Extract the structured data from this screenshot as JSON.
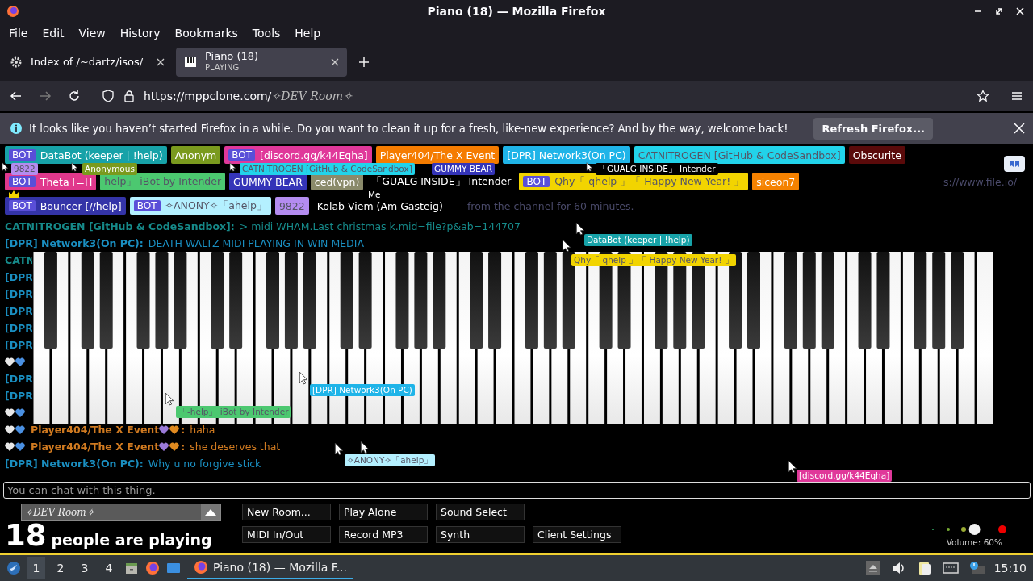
{
  "window": {
    "title": "Piano (18) — Mozilla Firefox"
  },
  "menu": [
    "File",
    "Edit",
    "View",
    "History",
    "Bookmarks",
    "Tools",
    "Help"
  ],
  "tabs": [
    {
      "title": "Index of /~dartz/isos/",
      "selected": false
    },
    {
      "title": "Piano (18)",
      "subtitle": "PLAYING",
      "selected": true
    }
  ],
  "address": {
    "url": "https://mppclone.com/",
    "room": "✧DEV Room✧"
  },
  "notification": {
    "message": "It looks like you haven’t started Firefox in a while. Do you want to clean it up for a fresh, like-new experience? And by the way, welcome back!",
    "button": "Refresh Firefox..."
  },
  "name_tags": [
    [
      {
        "badge": "BOT",
        "label": "DataBot (keeper | !help)",
        "color": "#17a2a8"
      },
      {
        "label": "Anonym",
        "color": "#7a9a1e"
      },
      {
        "badge": "BOT",
        "label": "[discord.gg/k44Eqha]",
        "color": "#e0389a"
      },
      {
        "label": "Player404/The X Event",
        "color": "#f57c00"
      },
      {
        "label": "[DPR] Network3(On PC)",
        "color": "#1fb4e8"
      },
      {
        "label": "CATNITROGEN [GitHub & CodeSandbox]",
        "color": "#22d3ea"
      },
      {
        "label": "Obscurite",
        "color": "#5a0a0a"
      }
    ],
    [
      {
        "badge": "BOT",
        "label": "Theta [=H",
        "color": "#e0388c"
      },
      {
        "label": "help」 iBot by Intender",
        "color": "#4cc870"
      },
      {
        "label": "GUMMY BEAR",
        "color": "#3434b8"
      },
      {
        "label": "ced(vpn)",
        "color": "#8a8a6a"
      },
      {
        "label": "「GUALG INSIDE」 Intender",
        "color": "#000000"
      },
      {
        "badge": "BOT",
        "label": "Qhy「 qhelp 」「 Happy New Year! 」",
        "color": "#f2d400"
      },
      {
        "label": "siceon7",
        "color": "#f58200"
      }
    ],
    [
      {
        "badge": "BOT",
        "label": "Bouncer [//help]",
        "color": "#3434a8"
      },
      {
        "badge": "BOT",
        "label": "✧ANONY✧「ahelp」",
        "color": "#b4f0ff"
      },
      {
        "label": "9822",
        "color": "#b48cf0"
      },
      {
        "label": "Kolab Viem (Am Gasteig)"
      }
    ]
  ],
  "faded_texts": [
    "from the channel for 60 minutes.",
    "s://www.file.io/"
  ],
  "cursor_labels": [
    {
      "label": "9822",
      "color": "#b48cf0"
    },
    {
      "label": "Anonymous",
      "color": "#7a9a1e"
    },
    {
      "label": "CATNITROGEN [GitHub & CodeSandbox]",
      "color": "#22d3ea"
    },
    {
      "label": "GUMMY BEAR",
      "color": "#3434b8"
    },
    {
      "label": "「GUALG INSIDE」 Intender",
      "color": "#000000"
    },
    {
      "label": "Me"
    },
    {
      "label": "DataBot (keeper | !help)",
      "color": "#17a2a8"
    },
    {
      "label": "Qhy「 qhelp 」「 Happy New Year! 」",
      "color": "#f2d400"
    },
    {
      "label": "[DPR] Network3(On PC)",
      "color": "#1fb4e8"
    },
    {
      "label": "「-help」 iBot by Intender",
      "color": "#4cc870"
    },
    {
      "label": "✧ANONY✧「ahelp」",
      "color": "#b4f0ff"
    },
    {
      "label": "[discord.gg/k44Eqha]",
      "color": "#e0389a"
    }
  ],
  "chat": [
    {
      "kind": "message",
      "name": "CATNITROGEN [GitHub & CodeSandbox]:",
      "text": "> midi WHAM.Last christmas k.mid=file?p&ab=144707",
      "color": "#168a8a"
    },
    {
      "kind": "message",
      "name": "[DPR] Network3(On PC):",
      "text": "DEATH WALTZ MIDI PLAYING IN WIN MEDIA",
      "color": "#1a8ec0"
    },
    {
      "kind": "cut",
      "name": "CATN",
      "color": "#168a8a"
    },
    {
      "kind": "cut",
      "name": "[DPR",
      "color": "#1a8ec0"
    },
    {
      "kind": "cut",
      "name": "[DPR",
      "color": "#1a8ec0"
    },
    {
      "kind": "cut",
      "name": "[DPR",
      "color": "#1a8ec0"
    },
    {
      "kind": "cut",
      "name": "[DPR",
      "color": "#1a8ec0"
    },
    {
      "kind": "cut",
      "name": "[DPR",
      "color": "#1a8ec0"
    },
    {
      "kind": "cut",
      "hearts": true
    },
    {
      "kind": "cut",
      "name": "[DPR",
      "color": "#1a8ec0"
    },
    {
      "kind": "cut",
      "name": "[DPR",
      "color": "#1a8ec0"
    },
    {
      "kind": "cut",
      "hearts": true
    },
    {
      "kind": "message",
      "hearts": true,
      "name": "Player404/The X Event",
      "separator": ":",
      "text": "haha",
      "color": "#d07a20"
    },
    {
      "kind": "message",
      "hearts": true,
      "name": "Player404/The X Event",
      "separator": ":",
      "text": "she deserves that",
      "color": "#d07a20"
    },
    {
      "kind": "message",
      "name": "[DPR] Network3(On PC):",
      "text": "Why u no forgive stick",
      "color": "#1a8ec0"
    }
  ],
  "chat_input": {
    "placeholder": "You can chat with this thing."
  },
  "room_select": {
    "value": "✧DEV Room✧"
  },
  "player_count": {
    "count": "18",
    "label": "people are playing"
  },
  "buttons": [
    [
      "New Room...",
      "Play Alone",
      "Sound Select"
    ],
    [
      "MIDI In/Out",
      "Record MP3",
      "Synth",
      "Client Settings"
    ]
  ],
  "volume": {
    "level": 0.6,
    "reading": "Volume: 60%"
  },
  "taskbar": {
    "workspaces": [
      {
        "label": "1",
        "selected": true
      },
      {
        "label": "2",
        "selected": false
      },
      {
        "label": "3",
        "selected": false
      },
      {
        "label": "4",
        "selected": false
      }
    ],
    "task": {
      "title": "Piano (18) — Mozilla F...",
      "selected": true
    },
    "clock": "15:10"
  }
}
